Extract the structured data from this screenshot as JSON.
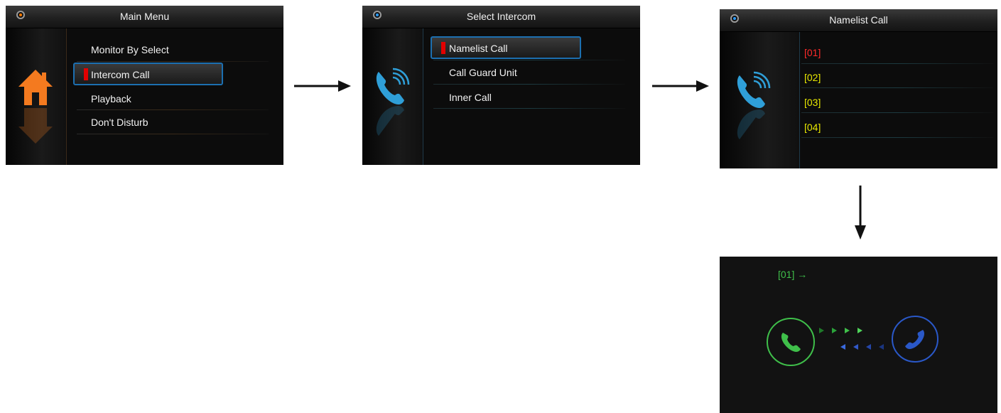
{
  "screen1": {
    "title": "Main Menu",
    "items": [
      "Monitor By Select",
      "Intercom Call",
      "Playback",
      "Don't Disturb"
    ],
    "selected_index": 1,
    "icon": "home-icon"
  },
  "screen2": {
    "title": "Select Intercom",
    "items": [
      "Namelist Call",
      "Call Guard Unit",
      "Inner Call"
    ],
    "selected_index": 0,
    "icon": "intercom-phone-icon"
  },
  "screen3": {
    "title": "Namelist Call",
    "items": [
      "[01]",
      "[02]",
      "[03]",
      "[04]"
    ],
    "selected_index": 0,
    "icon": "intercom-phone-icon"
  },
  "screen4": {
    "target": "[01] →",
    "icons": [
      "call-answer-icon",
      "call-remote-icon"
    ]
  },
  "colors": {
    "accent_orange": "#ff7a00",
    "accent_blue": "#1c6fb0",
    "selected_red": "#e30000",
    "list_yellow": "#e8e800",
    "call_green": "#3fbf4a",
    "call_blue": "#2a58c8"
  }
}
